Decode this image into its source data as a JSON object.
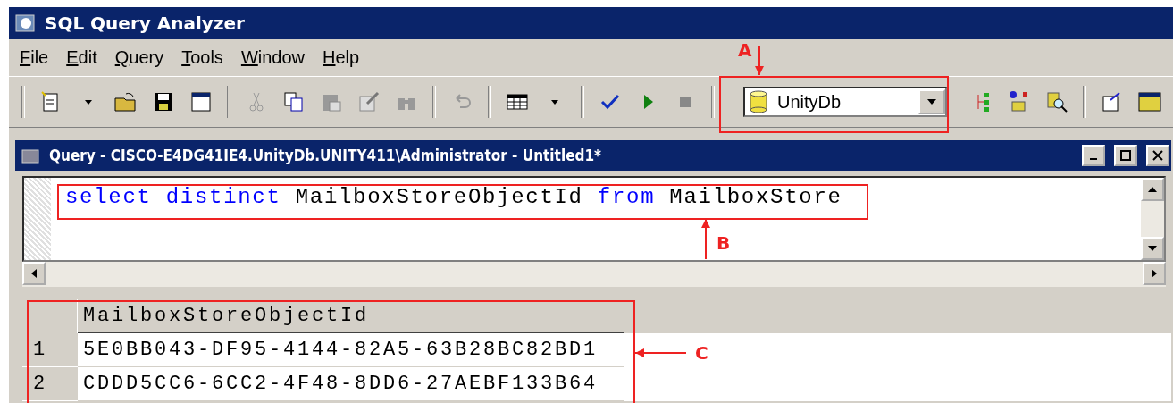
{
  "window": {
    "title": "SQL Query Analyzer"
  },
  "menu": [
    "File",
    "Edit",
    "Query",
    "Tools",
    "Window",
    "Help"
  ],
  "database_selector": {
    "value": "UnityDb"
  },
  "query_window": {
    "title": "Query - CISCO-E4DG41IE4.UnityDb.UNITY411\\Administrator - Untitled1*"
  },
  "query": [
    {
      "text": "select",
      "kind": "keyword"
    },
    {
      "text": "distinct",
      "kind": "keyword"
    },
    {
      "text": "MailboxStoreObjectId",
      "kind": "identifier"
    },
    {
      "text": "from",
      "kind": "keyword"
    },
    {
      "text": "MailboxStore",
      "kind": "identifier"
    }
  ],
  "results": {
    "columns": [
      "MailboxStoreObjectId"
    ],
    "rows": [
      {
        "number": "1",
        "cells": [
          "5E0BB043-DF95-4144-82A5-63B28BC82BD1"
        ]
      },
      {
        "number": "2",
        "cells": [
          "CDDD5CC6-6CC2-4F48-8DD6-27AEBF133B64"
        ]
      }
    ]
  },
  "annotations": [
    {
      "label": "A"
    },
    {
      "label": "B"
    },
    {
      "label": "C"
    }
  ]
}
